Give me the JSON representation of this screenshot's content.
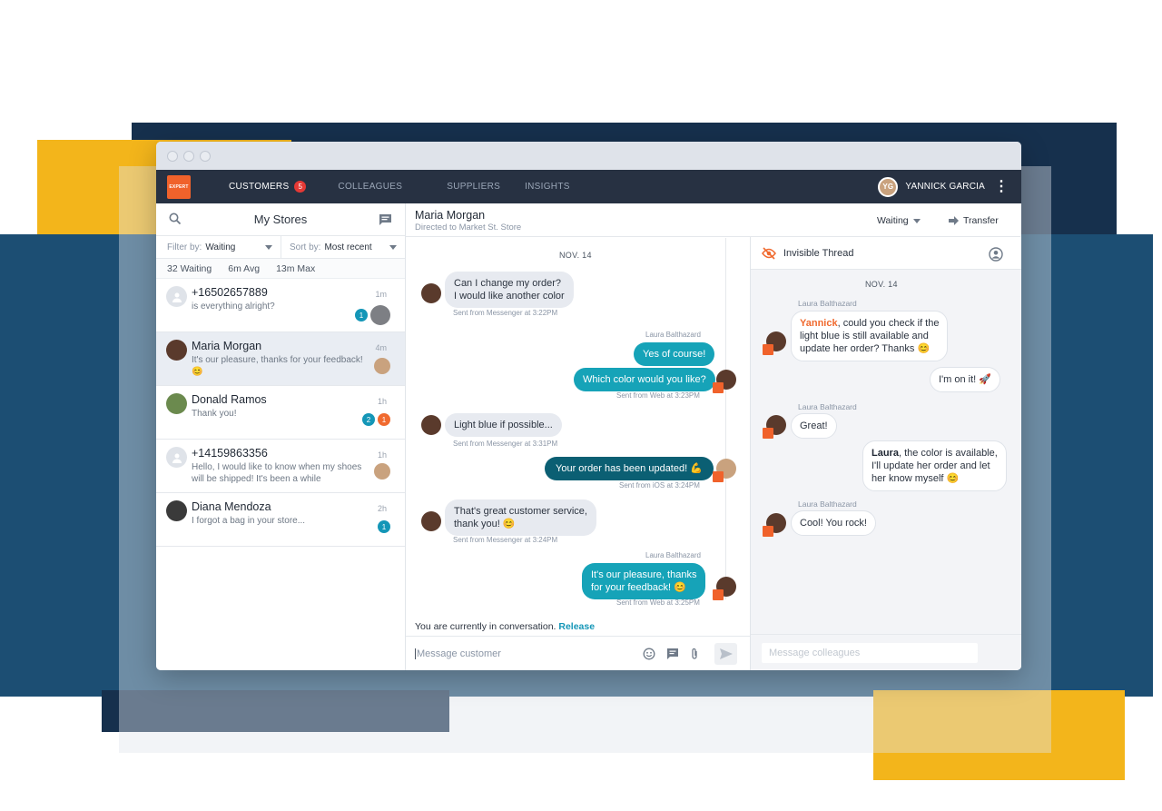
{
  "window": {
    "title": ""
  },
  "topnav": {
    "logo_text": "EXPERT",
    "tabs": [
      {
        "label": "CUSTOMERS",
        "badge": "5"
      },
      {
        "label": "COLLEAGUES"
      },
      {
        "label": "SUPPLIERS"
      },
      {
        "label": "INSIGHTS"
      }
    ],
    "user_name": "YANNICK GARCIA",
    "user_initials": "YG"
  },
  "sidebar": {
    "title": "My Stores",
    "filter_label": "Filter by:",
    "filter_value": "Waiting",
    "sort_label": "Sort by:",
    "sort_value": "Most recent",
    "stats": {
      "waiting": "32",
      "waiting_label": "Waiting",
      "avg": "6m Avg",
      "max": "13m Max"
    },
    "conversations": [
      {
        "name": "+16502657889",
        "time": "1m",
        "message": "is everything alright?",
        "badges": [
          "1"
        ]
      },
      {
        "name": "Maria Morgan",
        "time": "4m",
        "message": "It's our pleasure, thanks for your feedback! 😊",
        "badges": []
      },
      {
        "name": "Donald Ramos",
        "time": "1h",
        "message": "Thank you!",
        "badges": [
          "2",
          "1"
        ]
      },
      {
        "name": "+14159863356",
        "time": "1h",
        "message": "Hello, I would like to know when my shoes will be shipped! It's been a while",
        "badges": []
      },
      {
        "name": "Diana Mendoza",
        "time": "2h",
        "message": "I forgot a bag in your store...",
        "badges": [
          "1"
        ]
      }
    ]
  },
  "chat": {
    "customer_name": "Maria Morgan",
    "customer_sub": "Directed to Market St. Store",
    "status": "Waiting",
    "transfer": "Transfer",
    "day": "NOV. 14",
    "messages": [
      {
        "text1": "Can I change my order?",
        "text2": "I would like another color",
        "meta": "Sent from Messenger at 3:22PM"
      },
      {
        "sender": "Laura Balthazard",
        "text": "Yes of course!"
      },
      {
        "text": "Which color would you like?",
        "meta": "Sent from Web at 3:23PM"
      },
      {
        "text": "Light blue if possible...",
        "meta": "Sent from Messenger at 3:31PM"
      },
      {
        "text": "Your order has been updated! 💪",
        "meta": "Sent from iOS at 3:24PM"
      },
      {
        "text1": "That's great customer service,",
        "text2": "thank you! 😊",
        "meta": "Sent from Messenger at 3:24PM"
      },
      {
        "sender": "Laura Balthazard",
        "text1": "It's our pleasure, thanks",
        "text2": "for your feedback! 😊",
        "meta": "Sent from Web at 3:25PM"
      }
    ],
    "in_conversation": "You are currently in conversation.",
    "release": "Release",
    "composer_placeholder": "Message customer"
  },
  "invisible_thread": {
    "title": "Invisible Thread",
    "day": "NOV. 14",
    "messages": [
      {
        "sender": "Laura Balthazard",
        "mention": "Yannick",
        "text_a": ", could you check if the",
        "text_b": "light blue is still available and",
        "text_c": "update her order? Thanks 😊"
      },
      {
        "text": "I'm on it! 🚀"
      },
      {
        "sender": "Laura Balthazard",
        "text": "Great!"
      },
      {
        "mention": "Laura",
        "text_a": ", the color is available,",
        "text_b": "I'll update her order and let",
        "text_c": "her know myself 😊"
      },
      {
        "sender": "Laura Balthazard",
        "text": "Cool! You rock!"
      }
    ],
    "composer_placeholder": "Message colleagues"
  },
  "colors": {
    "accent_teal": "#16a3b8",
    "dark_teal": "#0b5f73",
    "nav": "#273142",
    "orange": "#f06a2f",
    "badge_red": "#e53935"
  }
}
